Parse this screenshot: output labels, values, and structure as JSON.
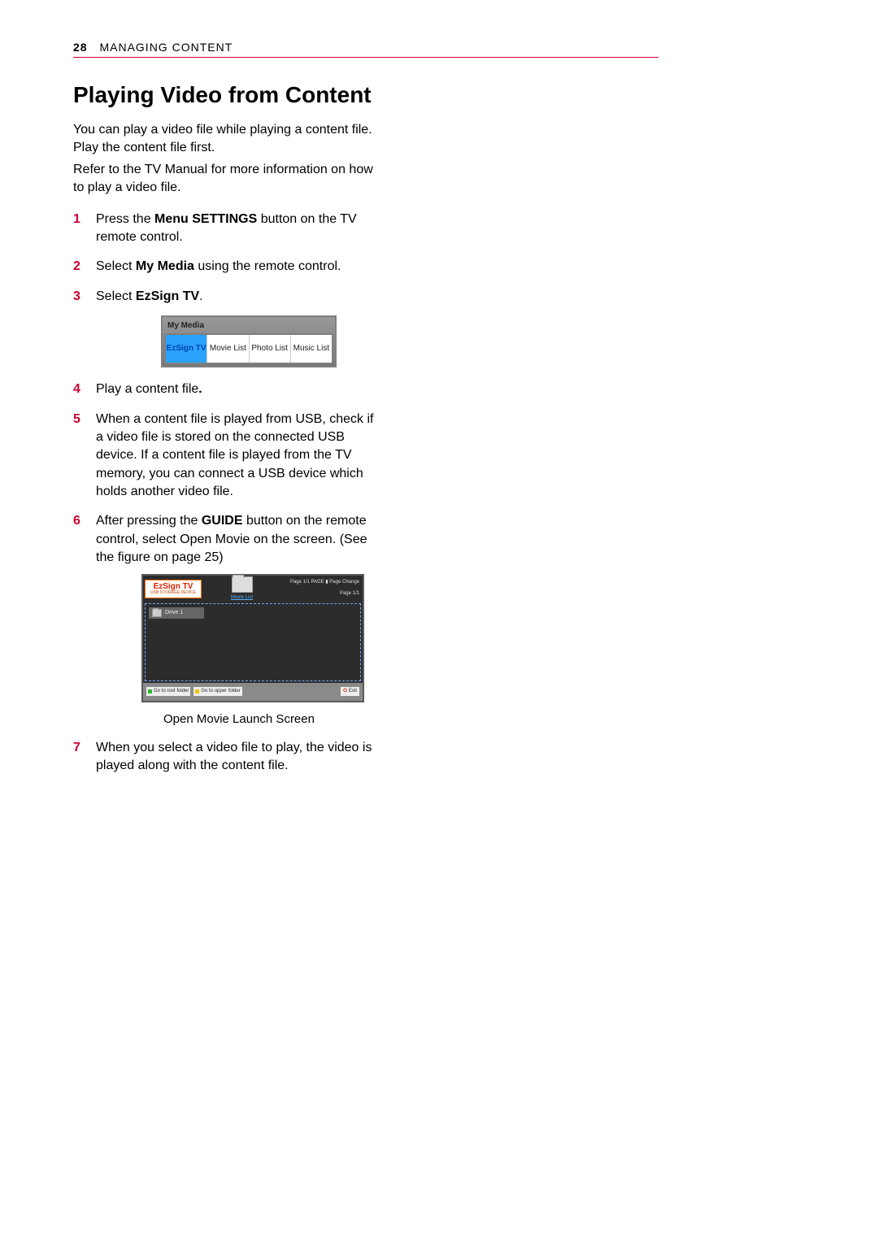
{
  "header": {
    "page_number": "28",
    "section": "MANAGING CONTENT"
  },
  "title": "Playing Video from Content",
  "intro": {
    "line1": "You can play a video file while playing a content file. Play the content file first.",
    "line2": "Refer to the TV Manual for more information on how to play a video file."
  },
  "steps": [
    {
      "num": "1",
      "text_a": "Press the ",
      "b1": "Menu SETTINGS",
      "text_b": " button on the TV remote control."
    },
    {
      "num": "2",
      "text_a": "Select ",
      "b1": "My Media",
      "text_b": " using the remote control."
    },
    {
      "num": "3",
      "text_a": "Select ",
      "b1": "EzSign TV",
      "text_b": "."
    },
    {
      "num": "4",
      "text_a": "Play a content file",
      "b1": ".",
      "text_b": ""
    },
    {
      "num": "5",
      "text_a": "When a content file is played from USB, check if a video file is stored on the connected USB device. If a content file is played from the TV memory, you can connect a USB device which holds another video file.",
      "b1": "",
      "text_b": ""
    },
    {
      "num": "6",
      "text_a": "After pressing the ",
      "b1": "GUIDE",
      "text_b": " button on the remote control, select Open Movie on the screen. (See the figure on page 25)"
    },
    {
      "num": "7",
      "text_a": "When you select a video file to play, the video is played along with the content file.",
      "b1": "",
      "text_b": ""
    }
  ],
  "mymedia": {
    "title": "My Media",
    "tabs": [
      "EzSign TV",
      "Movie List",
      "Photo List",
      "Music List"
    ]
  },
  "moviefig": {
    "badge_title": "EzSign TV",
    "badge_sub": "USB STORAGE DEVICE",
    "folder_label": "Movie List",
    "page_a": "Page 1/1",
    "page_change": "PAGE ▮ Page Change",
    "page_b": "Page 1/1",
    "drive": "Drive 1",
    "btn_root": "Go to root folder",
    "btn_upper": "Go to upper folder",
    "exit": "Exit",
    "caption": "Open Movie Launch Screen"
  }
}
